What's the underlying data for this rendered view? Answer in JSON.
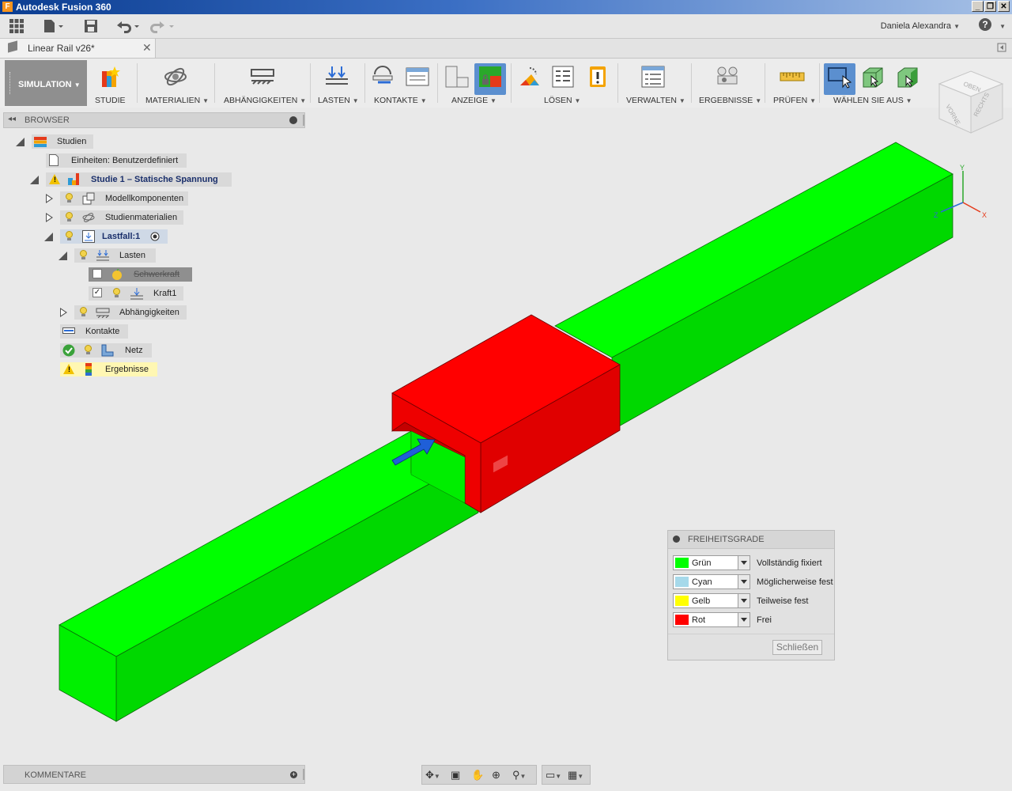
{
  "window": {
    "title": "Autodesk Fusion 360",
    "app_icon_letter": "F"
  },
  "quick_access": {
    "user": "Daniela Alexandra",
    "help_label": "?"
  },
  "document_tab": {
    "name": "Linear Rail v26*",
    "close": "✕"
  },
  "toolbar": {
    "workspace": "SIMULATION",
    "groups": [
      {
        "label": "STUDIE",
        "icon": "study-icon"
      },
      {
        "label": "MATERIALIEN",
        "icon": "materials-icon",
        "dropdown": true
      },
      {
        "label": "ABHÄNGIGKEITEN",
        "icon": "constraints-icon",
        "dropdown": true
      },
      {
        "label": "LASTEN",
        "icon": "loads-icon",
        "dropdown": true
      },
      {
        "label": "KONTAKTE",
        "icon": "contacts-icon",
        "dropdown": true
      },
      {
        "label": "ANZEIGE",
        "icon": "display-icon",
        "dropdown": true
      },
      {
        "label": "LÖSEN",
        "icon": "solve-icon",
        "dropdown": true
      },
      {
        "label": "VERWALTEN",
        "icon": "manage-icon",
        "dropdown": true
      },
      {
        "label": "ERGEBNISSE",
        "icon": "results-icon",
        "dropdown": true
      },
      {
        "label": "PRÜFEN",
        "icon": "inspect-icon",
        "dropdown": true
      },
      {
        "label": "WÄHLEN SIE AUS",
        "icon": "select-icon",
        "dropdown": true
      }
    ]
  },
  "browser": {
    "title": "BROWSER",
    "tree": {
      "studien": "Studien",
      "units": "Einheiten: Benutzerdefiniert",
      "study1": "Studie 1 – Statische Spannung",
      "model_components": "Modellkomponenten",
      "study_materials": "Studienmaterialien",
      "loadcase": "Lastfall:1",
      "loads": "Lasten",
      "gravity": "Schwerkraft",
      "force1": "Kraft1",
      "constraints": "Abhängigkeiten",
      "contacts": "Kontakte",
      "mesh": "Netz",
      "results": "Ergebnisse"
    }
  },
  "viewcube": {
    "top": "OBEN",
    "front": "VORNE",
    "right": "RECHTS"
  },
  "axes": {
    "x": "X",
    "y": "Y",
    "z": "Z"
  },
  "dof_panel": {
    "title": "FREIHEITSGRADE",
    "rows": [
      {
        "color_name": "Grün",
        "color": "#00ff00",
        "meaning": "Vollständig fixiert"
      },
      {
        "color_name": "Cyan",
        "color": "#a6d9ea",
        "meaning": "Möglicherweise fest"
      },
      {
        "color_name": "Gelb",
        "color": "#ffff00",
        "meaning": "Teilweise fest"
      },
      {
        "color_name": "Rot",
        "color": "#ff0000",
        "meaning": "Frei"
      }
    ],
    "close_label": "Schließen"
  },
  "comments": {
    "title": "KOMMENTARE"
  },
  "colors": {
    "rail_green": "#00e600",
    "carriage_red": "#e00000",
    "force_arrow": "#1f5fd8"
  }
}
